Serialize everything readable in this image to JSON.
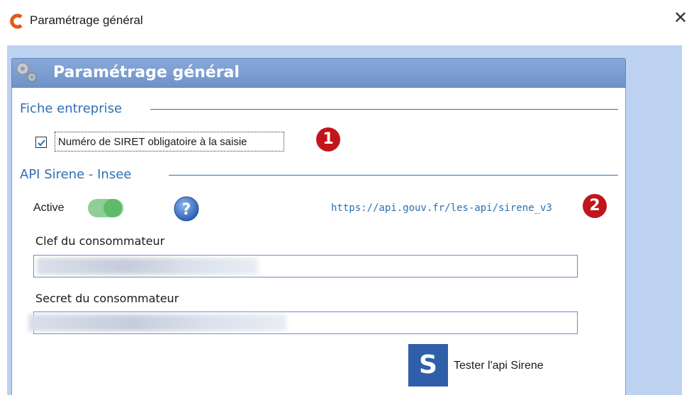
{
  "window": {
    "title": "Paramétrage général",
    "close_glyph": "✕"
  },
  "panel": {
    "title": "Paramétrage général",
    "icon": "gears-icon"
  },
  "fiche": {
    "section_title": "Fiche entreprise",
    "siret_checkbox": {
      "label": "Numéro de SIRET obligatoire à la saisie",
      "checked": true
    },
    "badge": "1"
  },
  "api": {
    "section_title": "API Sirene - Insee",
    "active_label": "Active",
    "active": true,
    "link": "https://api.gouv.fr/les-api/sirene_v3",
    "badge": "2",
    "consumer_key_label": "Clef du consommateur",
    "consumer_key_value": "",
    "consumer_secret_label": "Secret du consommateur",
    "consumer_secret_value": "",
    "test_button": {
      "icon_letter": "S",
      "label": "Tester l'api Sirene"
    }
  },
  "colors": {
    "accent": "#2f6fb3",
    "header": "#7a9ccf",
    "badge": "#c0161b",
    "toggle": "#5dbb69"
  }
}
